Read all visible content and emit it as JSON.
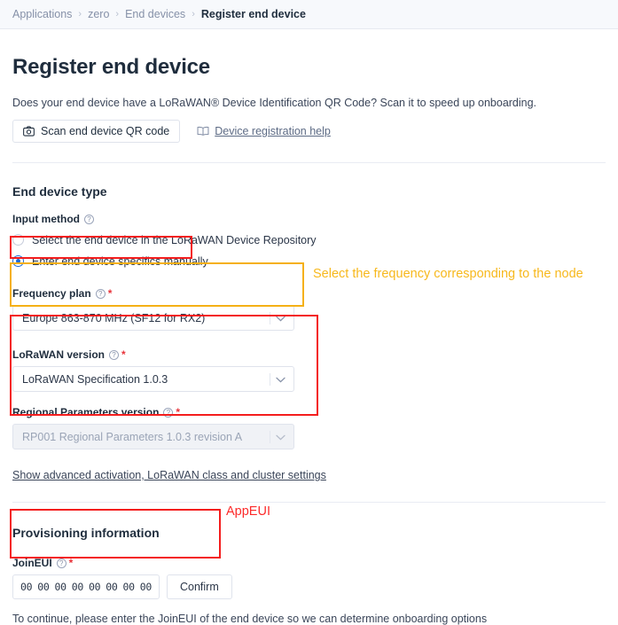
{
  "breadcrumb": {
    "items": [
      "Applications",
      "zero",
      "End devices",
      "Register end device"
    ],
    "separator": "›"
  },
  "page": {
    "title": "Register end device",
    "intro": "Does your end device have a LoRaWAN® Device Identification QR Code? Scan it to speed up onboarding.",
    "scan_button": "Scan end device QR code",
    "help_link": "Device registration help"
  },
  "end_device_type": {
    "section_title": "End device type",
    "input_method_label": "Input method",
    "options": [
      {
        "label": "Select the end device in the LoRaWAN Device Repository",
        "selected": false
      },
      {
        "label": "Enter end device specifics manually",
        "selected": true
      }
    ]
  },
  "frequency_plan": {
    "label": "Frequency plan",
    "required": "*",
    "value": "Europe 863-870 MHz (SF12 for RX2)"
  },
  "lorawan_version": {
    "label": "LoRaWAN version",
    "required": "*",
    "value": "LoRaWAN Specification 1.0.3"
  },
  "regional_parameters": {
    "label": "Regional Parameters version",
    "required": "*",
    "value": "RP001 Regional Parameters 1.0.3 revision A",
    "disabled": true
  },
  "advanced_link": "Show advanced activation, LoRaWAN class and cluster settings",
  "provisioning": {
    "section_title": "Provisioning information",
    "joineui_label": "JoinEUI",
    "required": "*",
    "bytes": [
      "00",
      "00",
      "00",
      "00",
      "00",
      "00",
      "00",
      "00"
    ],
    "confirm_button": "Confirm",
    "hint": "To continue, please enter the JoinEUI of the end device so we can determine onboarding options"
  },
  "annotations": {
    "frequency_note": "Select the frequency corresponding to the node",
    "joineui_note": "AppEUI",
    "colors": {
      "red": "#f41d1d",
      "orange": "#f5b016"
    }
  }
}
